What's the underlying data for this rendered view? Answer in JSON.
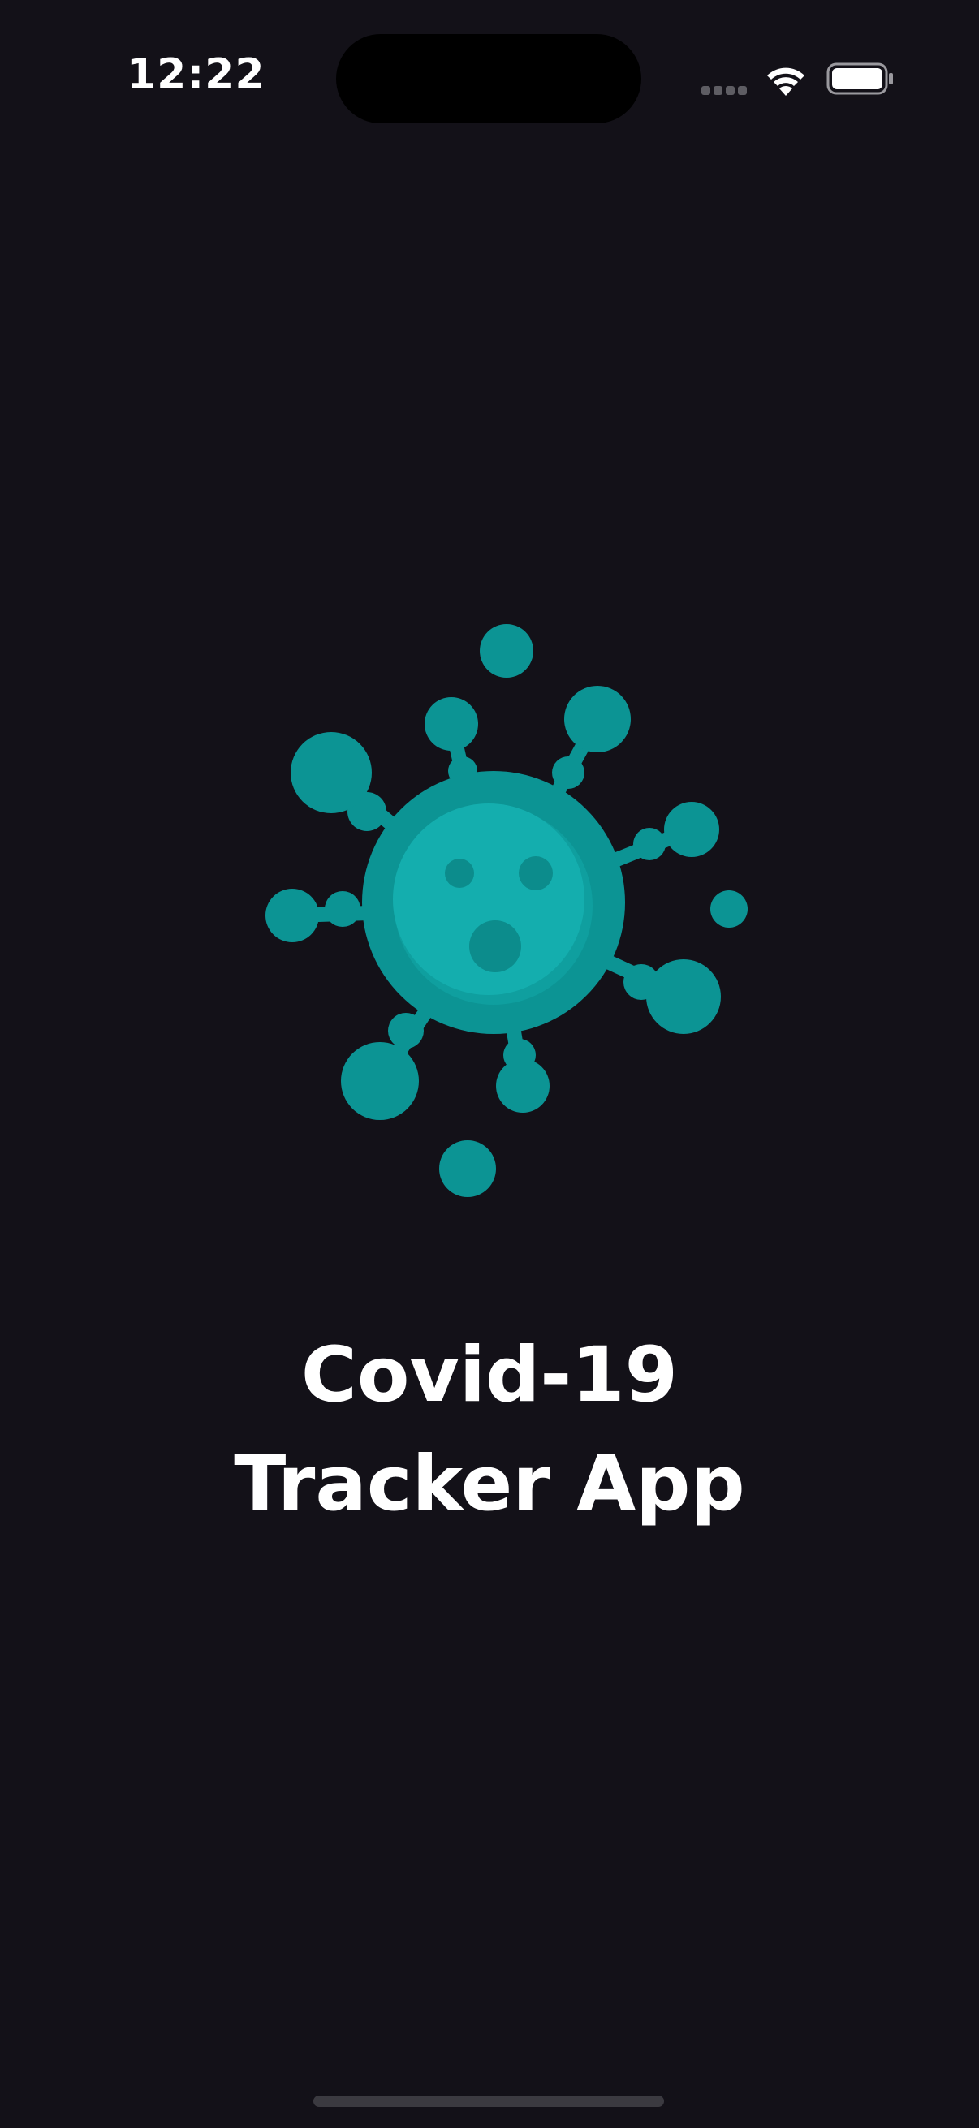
{
  "status_bar": {
    "time": "12:22",
    "icons": [
      "signal-icon",
      "wifi-icon",
      "battery-icon"
    ]
  },
  "splash": {
    "logo_icon": "virus-icon",
    "title_line_1": "Covid-19",
    "title_line_2": "Tracker App"
  },
  "colors": {
    "background": "#131118",
    "virus_primary": "#0c9494",
    "virus_face": "#13acac",
    "text": "#ffffff"
  }
}
